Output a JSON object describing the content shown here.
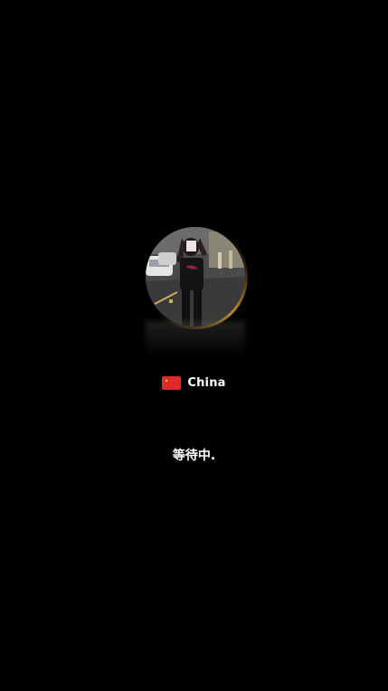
{
  "caller": {
    "country": "China",
    "flag": "cn-flag-icon"
  },
  "status": {
    "text": "等待中."
  },
  "colors": {
    "background": "#000000",
    "glow": "#f0aa32",
    "text": "#ffffff"
  }
}
